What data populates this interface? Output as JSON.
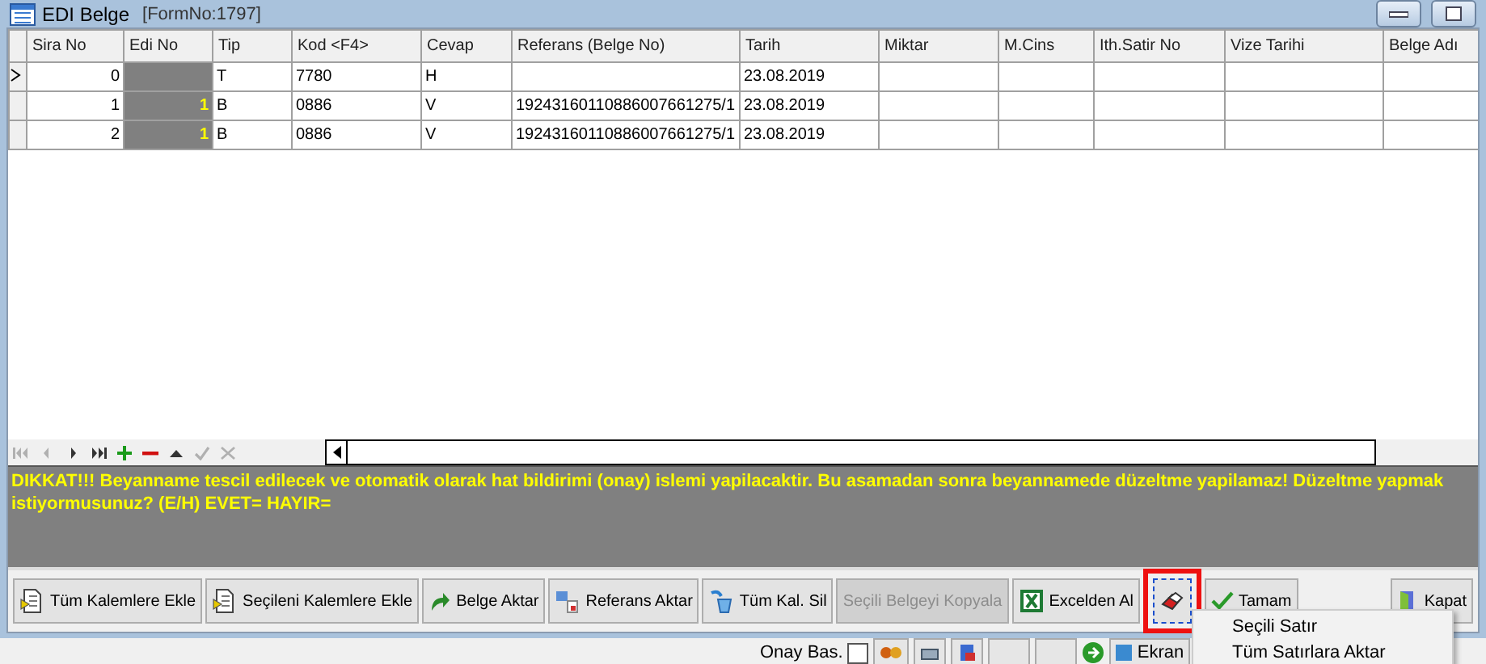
{
  "window": {
    "title": "EDI Belge",
    "form_no": "[FormNo:1797]"
  },
  "table": {
    "columns": [
      "Sira No",
      "Edi No",
      "Tip",
      "Kod <F4>",
      "Cevap",
      "Referans (Belge No)",
      "Tarih",
      "Miktar",
      "M.Cins",
      "Ith.Satir No",
      "Vize Tarihi",
      "Belge Adı"
    ],
    "rows": [
      {
        "current": true,
        "cells": [
          "0",
          "",
          "T",
          "7780",
          "H",
          "",
          "23.08.2019",
          "",
          "",
          "",
          "",
          ""
        ]
      },
      {
        "current": false,
        "cells": [
          "1",
          "1",
          "B",
          "0886",
          "V",
          "19243160110886007661275/1",
          "23.08.2019",
          "",
          "",
          "",
          "",
          ""
        ]
      },
      {
        "current": false,
        "cells": [
          "2",
          "1",
          "B",
          "0886",
          "V",
          "19243160110886007661275/1",
          "23.08.2019",
          "",
          "",
          "",
          "",
          ""
        ]
      }
    ]
  },
  "navigator": [
    {
      "kind": "first",
      "disabled": true
    },
    {
      "kind": "prior",
      "disabled": true
    },
    {
      "kind": "next",
      "disabled": false
    },
    {
      "kind": "last",
      "disabled": false
    },
    {
      "kind": "insert",
      "disabled": false
    },
    {
      "kind": "delete",
      "disabled": false
    },
    {
      "kind": "edit",
      "disabled": false
    },
    {
      "kind": "post",
      "disabled": true
    },
    {
      "kind": "cancel",
      "disabled": true
    }
  ],
  "message": "DIKKAT!!! Beyanname tescil edilecek ve otomatik olarak hat bildirimi (onay) islemi yapilacaktir. Bu asamadan sonra beyannamede düzeltme yapilamaz! Düzeltme yapmak istiyormusunuz? (E/H) EVET= HAYIR=",
  "buttons": [
    {
      "kind": "doc",
      "label": "Tüm Kalemlere Ekle",
      "disabled": false,
      "outlined": false
    },
    {
      "kind": "doc",
      "label": "Seçileni Kalemlere Ekle",
      "disabled": false,
      "outlined": false
    },
    {
      "kind": "arrow",
      "label": "Belge Aktar",
      "disabled": false,
      "outlined": false
    },
    {
      "kind": "ref",
      "label": "Referans Aktar",
      "disabled": false,
      "outlined": false
    },
    {
      "kind": "erase",
      "label": "Tüm Kal. Sil",
      "disabled": false,
      "outlined": false
    },
    {
      "kind": "none",
      "label": "Seçili Belgeyi Kopyala",
      "disabled": true,
      "outlined": false
    },
    {
      "kind": "excel",
      "label": "Excelden Al",
      "disabled": false,
      "outlined": false
    },
    {
      "kind": "eraser",
      "disabled": false,
      "outlined": true
    },
    {
      "kind": "check",
      "label": "Tamam",
      "disabled": false,
      "outlined": false
    },
    {
      "kind": "exit",
      "label": "Kapat",
      "disabled": false,
      "outlined": false
    }
  ],
  "popup_menu": [
    "Seçili Satır",
    "Tüm Satırlara Aktar"
  ],
  "bottom_bar": {
    "checkbox_label": "Onay Bas.",
    "checked": false,
    "screen_button": "Ekran"
  }
}
